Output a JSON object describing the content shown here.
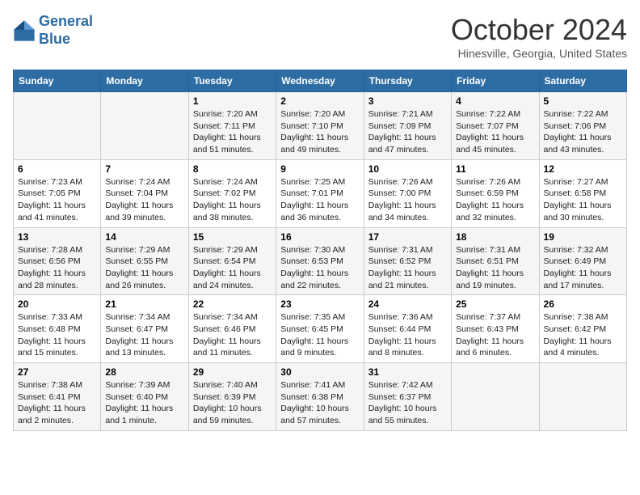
{
  "logo": {
    "general": "General",
    "blue": "Blue"
  },
  "title": "October 2024",
  "location": "Hinesville, Georgia, United States",
  "days_of_week": [
    "Sunday",
    "Monday",
    "Tuesday",
    "Wednesday",
    "Thursday",
    "Friday",
    "Saturday"
  ],
  "weeks": [
    [
      {
        "day": "",
        "info": ""
      },
      {
        "day": "",
        "info": ""
      },
      {
        "day": "1",
        "info": "Sunrise: 7:20 AM\nSunset: 7:11 PM\nDaylight: 11 hours and 51 minutes."
      },
      {
        "day": "2",
        "info": "Sunrise: 7:20 AM\nSunset: 7:10 PM\nDaylight: 11 hours and 49 minutes."
      },
      {
        "day": "3",
        "info": "Sunrise: 7:21 AM\nSunset: 7:09 PM\nDaylight: 11 hours and 47 minutes."
      },
      {
        "day": "4",
        "info": "Sunrise: 7:22 AM\nSunset: 7:07 PM\nDaylight: 11 hours and 45 minutes."
      },
      {
        "day": "5",
        "info": "Sunrise: 7:22 AM\nSunset: 7:06 PM\nDaylight: 11 hours and 43 minutes."
      }
    ],
    [
      {
        "day": "6",
        "info": "Sunrise: 7:23 AM\nSunset: 7:05 PM\nDaylight: 11 hours and 41 minutes."
      },
      {
        "day": "7",
        "info": "Sunrise: 7:24 AM\nSunset: 7:04 PM\nDaylight: 11 hours and 39 minutes."
      },
      {
        "day": "8",
        "info": "Sunrise: 7:24 AM\nSunset: 7:02 PM\nDaylight: 11 hours and 38 minutes."
      },
      {
        "day": "9",
        "info": "Sunrise: 7:25 AM\nSunset: 7:01 PM\nDaylight: 11 hours and 36 minutes."
      },
      {
        "day": "10",
        "info": "Sunrise: 7:26 AM\nSunset: 7:00 PM\nDaylight: 11 hours and 34 minutes."
      },
      {
        "day": "11",
        "info": "Sunrise: 7:26 AM\nSunset: 6:59 PM\nDaylight: 11 hours and 32 minutes."
      },
      {
        "day": "12",
        "info": "Sunrise: 7:27 AM\nSunset: 6:58 PM\nDaylight: 11 hours and 30 minutes."
      }
    ],
    [
      {
        "day": "13",
        "info": "Sunrise: 7:28 AM\nSunset: 6:56 PM\nDaylight: 11 hours and 28 minutes."
      },
      {
        "day": "14",
        "info": "Sunrise: 7:29 AM\nSunset: 6:55 PM\nDaylight: 11 hours and 26 minutes."
      },
      {
        "day": "15",
        "info": "Sunrise: 7:29 AM\nSunset: 6:54 PM\nDaylight: 11 hours and 24 minutes."
      },
      {
        "day": "16",
        "info": "Sunrise: 7:30 AM\nSunset: 6:53 PM\nDaylight: 11 hours and 22 minutes."
      },
      {
        "day": "17",
        "info": "Sunrise: 7:31 AM\nSunset: 6:52 PM\nDaylight: 11 hours and 21 minutes."
      },
      {
        "day": "18",
        "info": "Sunrise: 7:31 AM\nSunset: 6:51 PM\nDaylight: 11 hours and 19 minutes."
      },
      {
        "day": "19",
        "info": "Sunrise: 7:32 AM\nSunset: 6:49 PM\nDaylight: 11 hours and 17 minutes."
      }
    ],
    [
      {
        "day": "20",
        "info": "Sunrise: 7:33 AM\nSunset: 6:48 PM\nDaylight: 11 hours and 15 minutes."
      },
      {
        "day": "21",
        "info": "Sunrise: 7:34 AM\nSunset: 6:47 PM\nDaylight: 11 hours and 13 minutes."
      },
      {
        "day": "22",
        "info": "Sunrise: 7:34 AM\nSunset: 6:46 PM\nDaylight: 11 hours and 11 minutes."
      },
      {
        "day": "23",
        "info": "Sunrise: 7:35 AM\nSunset: 6:45 PM\nDaylight: 11 hours and 9 minutes."
      },
      {
        "day": "24",
        "info": "Sunrise: 7:36 AM\nSunset: 6:44 PM\nDaylight: 11 hours and 8 minutes."
      },
      {
        "day": "25",
        "info": "Sunrise: 7:37 AM\nSunset: 6:43 PM\nDaylight: 11 hours and 6 minutes."
      },
      {
        "day": "26",
        "info": "Sunrise: 7:38 AM\nSunset: 6:42 PM\nDaylight: 11 hours and 4 minutes."
      }
    ],
    [
      {
        "day": "27",
        "info": "Sunrise: 7:38 AM\nSunset: 6:41 PM\nDaylight: 11 hours and 2 minutes."
      },
      {
        "day": "28",
        "info": "Sunrise: 7:39 AM\nSunset: 6:40 PM\nDaylight: 11 hours and 1 minute."
      },
      {
        "day": "29",
        "info": "Sunrise: 7:40 AM\nSunset: 6:39 PM\nDaylight: 10 hours and 59 minutes."
      },
      {
        "day": "30",
        "info": "Sunrise: 7:41 AM\nSunset: 6:38 PM\nDaylight: 10 hours and 57 minutes."
      },
      {
        "day": "31",
        "info": "Sunrise: 7:42 AM\nSunset: 6:37 PM\nDaylight: 10 hours and 55 minutes."
      },
      {
        "day": "",
        "info": ""
      },
      {
        "day": "",
        "info": ""
      }
    ]
  ]
}
